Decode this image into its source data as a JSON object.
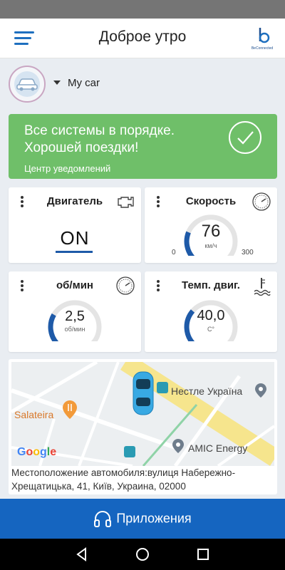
{
  "header": {
    "title": "Доброе утро",
    "brand_text": "BeConnected",
    "brand_color": "#1e4f8f"
  },
  "car": {
    "name": "My car"
  },
  "notice": {
    "line1": "Все системы в порядке.",
    "line2": "Хорошей поездки!",
    "link": "Центр уведомлений",
    "color": "#6fbf69"
  },
  "cards": {
    "engine": {
      "title": "Двигатель",
      "state": "ON"
    },
    "speed": {
      "title": "Скорость",
      "value": "76",
      "unit": "км/ч",
      "min": "0",
      "max": "300",
      "fraction": 0.25
    },
    "rpm": {
      "title": "об/мин",
      "value": "2,5",
      "unit": "об/мин",
      "fraction": 0.28
    },
    "temp": {
      "title": "Темп. двиг.",
      "value": "40,0",
      "unit": "C°",
      "fraction": 0.32
    }
  },
  "map": {
    "poi_nestle": "Нестле Україна",
    "poi_salateira": "Salateira",
    "poi_amic": "AMIC Energy",
    "google": "Google",
    "address": "Местоположение автомобиля:вулиця Набережно-Хрещатицька, 41, Київ, Украина, 02000"
  },
  "apps": {
    "label": "Приложения",
    "color": "#1565c0"
  },
  "accent": "#1e6fbf"
}
